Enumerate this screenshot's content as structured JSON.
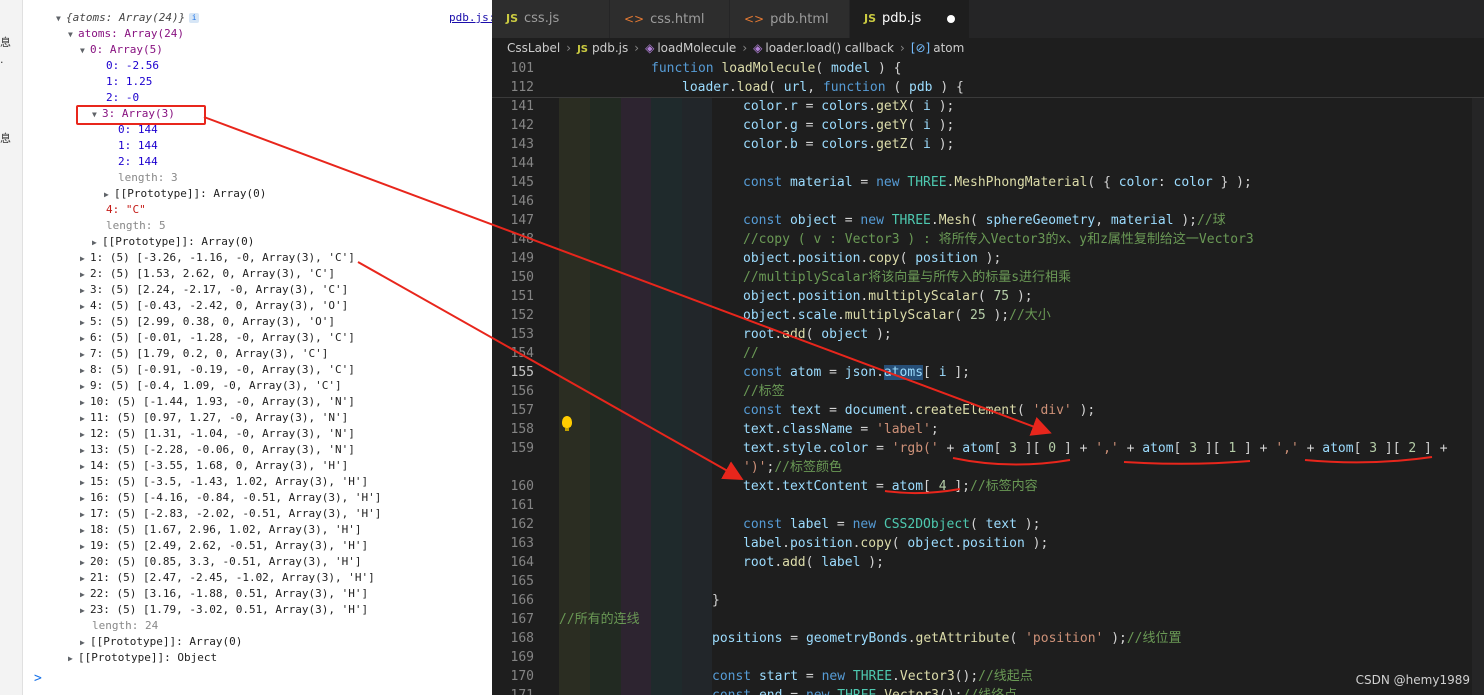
{
  "console": {
    "header": "{atoms: Array(24)}",
    "source_link": "pdb.js:",
    "left_gutter": [
      "息",
      "·",
      "息"
    ],
    "atoms_key": "atoms: Array(24)",
    "atom0": "0: Array(5)",
    "atom0_items": [
      "0: -2.56",
      "1: 1.25",
      "2: -0"
    ],
    "atom0_color": "3: Array(3)",
    "color_items": [
      "0: 144",
      "1: 144",
      "2: 144"
    ],
    "color_length": "length: 3",
    "color_proto": "[[Prototype]]: Array(0)",
    "atom0_symbol": "4: \"C\"",
    "atom0_length": "length: 5",
    "atom0_proto": "[[Prototype]]: Array(0)",
    "rows": [
      "1: (5) [-3.26, -1.16, -0, Array(3), 'C']",
      "2: (5) [1.53, 2.62, 0, Array(3), 'C']",
      "3: (5) [2.24, -2.17, -0, Array(3), 'C']",
      "4: (5) [-0.43, -2.42, 0, Array(3), 'O']",
      "5: (5) [2.99, 0.38, 0, Array(3), 'O']",
      "6: (5) [-0.01, -1.28, -0, Array(3), 'C']",
      "7: (5) [1.79, 0.2, 0, Array(3), 'C']",
      "8: (5) [-0.91, -0.19, -0, Array(3), 'C']",
      "9: (5) [-0.4, 1.09, -0, Array(3), 'C']",
      "10: (5) [-1.44, 1.93, -0, Array(3), 'N']",
      "11: (5) [0.97, 1.27, -0, Array(3), 'N']",
      "12: (5) [1.31, -1.04, -0, Array(3), 'N']",
      "13: (5) [-2.28, -0.06, 0, Array(3), 'N']",
      "14: (5) [-3.55, 1.68, 0, Array(3), 'H']",
      "15: (5) [-3.5, -1.43, 1.02, Array(3), 'H']",
      "16: (5) [-4.16, -0.84, -0.51, Array(3), 'H']",
      "17: (5) [-2.83, -2.02, -0.51, Array(3), 'H']",
      "18: (5) [1.67, 2.96, 1.02, Array(3), 'H']",
      "19: (5) [2.49, 2.62, -0.51, Array(3), 'H']",
      "20: (5) [0.85, 3.3, -0.51, Array(3), 'H']",
      "21: (5) [2.47, -2.45, -1.02, Array(3), 'H']",
      "22: (5) [3.16, -1.88, 0.51, Array(3), 'H']",
      "23: (5) [1.79, -3.02, 0.51, Array(3), 'H']"
    ],
    "atoms_length": "length: 24",
    "atoms_proto": "[[Prototype]]: Array(0)",
    "root_proto": "[[Prototype]]: Object",
    "prompt": ">"
  },
  "editor": {
    "tabs": [
      {
        "icon": "JS",
        "label": "css.js"
      },
      {
        "icon": "<>",
        "label": "css.html"
      },
      {
        "icon": "<>",
        "label": "pdb.html"
      },
      {
        "icon": "JS",
        "label": "pdb.js"
      }
    ],
    "breadcrumbs": [
      "CssLabel",
      "pdb.js",
      "loadMolecule",
      "loader.load() callback",
      "atom"
    ],
    "breadcrumb_js": "JS",
    "sticky": [
      {
        "ln": "101",
        "code": "function loadMolecule( model ) {"
      },
      {
        "ln": "112",
        "code": "loader.load( url, function ( pdb ) {"
      }
    ],
    "lines": [
      {
        "ln": "141",
        "code": "color.r = colors.getX( i );"
      },
      {
        "ln": "142",
        "code": "color.g = colors.getY( i );"
      },
      {
        "ln": "143",
        "code": "color.b = colors.getZ( i );"
      },
      {
        "ln": "144",
        "code": ""
      },
      {
        "ln": "145",
        "code": "const material = new THREE.MeshPhongMaterial( { color: color } );"
      },
      {
        "ln": "146",
        "code": ""
      },
      {
        "ln": "147",
        "code": "const object = new THREE.Mesh( sphereGeometry, material );//球"
      },
      {
        "ln": "148",
        "code": "//copy ( v : Vector3 ) : 将所传入Vector3的x、y和z属性复制给这一Vector3"
      },
      {
        "ln": "149",
        "code": "object.position.copy( position );"
      },
      {
        "ln": "150",
        "code": "//multiplyScalar将该向量与所传入的标量s进行相乘"
      },
      {
        "ln": "151",
        "code": "object.position.multiplyScalar( 75 );"
      },
      {
        "ln": "152",
        "code": "object.scale.multiplyScalar( 25 );//大小"
      },
      {
        "ln": "153",
        "code": "root.add( object );"
      },
      {
        "ln": "154",
        "code": "//"
      },
      {
        "ln": "155",
        "code": "const atom = json.atoms[ i ];"
      },
      {
        "ln": "156",
        "code": "//标签"
      },
      {
        "ln": "157",
        "code": "const text = document.createElement( 'div' );"
      },
      {
        "ln": "158",
        "code": "text.className = 'label';"
      },
      {
        "ln": "159",
        "code": "text.style.color = 'rgb(' + atom[ 3 ][ 0 ] + ',' + atom[ 3 ][ 1 ] + ',' + atom[ 3 ][ 2 ] +"
      },
      {
        "ln": "",
        "code": "')';//标签颜色"
      },
      {
        "ln": "160",
        "code": "text.textContent = atom[ 4 ];//标签内容"
      },
      {
        "ln": "161",
        "code": ""
      },
      {
        "ln": "162",
        "code": "const label = new CSS2DObject( text );"
      },
      {
        "ln": "163",
        "code": "label.position.copy( object.position );"
      },
      {
        "ln": "164",
        "code": "root.add( label );"
      },
      {
        "ln": "165",
        "code": ""
      },
      {
        "ln": "166",
        "code": "}"
      },
      {
        "ln": "167",
        "code": "//所有的连线"
      },
      {
        "ln": "168",
        "code": "positions = geometryBonds.getAttribute( 'position' );//线位置"
      },
      {
        "ln": "169",
        "code": ""
      },
      {
        "ln": "170",
        "code": "const start = new THREE.Vector3();//线起点"
      },
      {
        "ln": "171",
        "code": "const end = new THREE.Vector3();//线终点"
      }
    ]
  },
  "watermark": "CSDN @hemy1989",
  "colors": {
    "annotation_red": "#e8261c"
  }
}
